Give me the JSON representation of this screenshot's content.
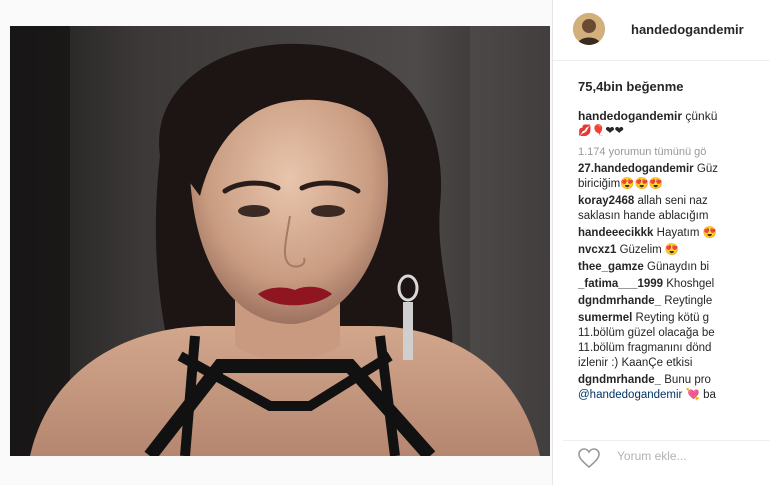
{
  "post": {
    "username": "handedogandemir",
    "likes": "75,4bin beğenme",
    "caption_user": "handedogandemir",
    "caption_text": "çünkü",
    "caption_emojis": "💋🎈❤❤",
    "view_all": "1.174 yorumun tümünü gö",
    "add_comment_placeholder": "Yorum ekle..."
  },
  "comments": [
    {
      "user": "27.handedogandemir",
      "text": "Güz",
      "cont": "biriciğim😍😍😍"
    },
    {
      "user": "koray2468",
      "text": "allah seni naz",
      "cont": "saklasın hande ablacığım"
    },
    {
      "user": "handeeecikkk",
      "text": "Hayatım 😍",
      "cont": ""
    },
    {
      "user": "nvcxz1",
      "text": "Güzelim 😍",
      "cont": ""
    },
    {
      "user": "thee_gamze",
      "text": "Günaydın bi",
      "cont": ""
    },
    {
      "user": "_fatima___1999",
      "text": "Khoshgel",
      "cont": ""
    },
    {
      "user": "dgndmrhande_",
      "text": "Reytingle",
      "cont": ""
    },
    {
      "user": "sumermel",
      "text": "Reyting kötü g",
      "cont": "11.bölüm güzel olacağa be",
      "cont2": "11.bölüm fragmanını dönd",
      "cont3": "izlenir :) KaanÇe etkisi"
    },
    {
      "user": "dgndmrhande_",
      "text": "Bunu pro",
      "mention": "@handedogandemir",
      "cont_end": "💘 ba"
    }
  ],
  "colors": {
    "text": "#262626",
    "muted": "#999999",
    "link": "#003569",
    "border": "#efefef"
  }
}
